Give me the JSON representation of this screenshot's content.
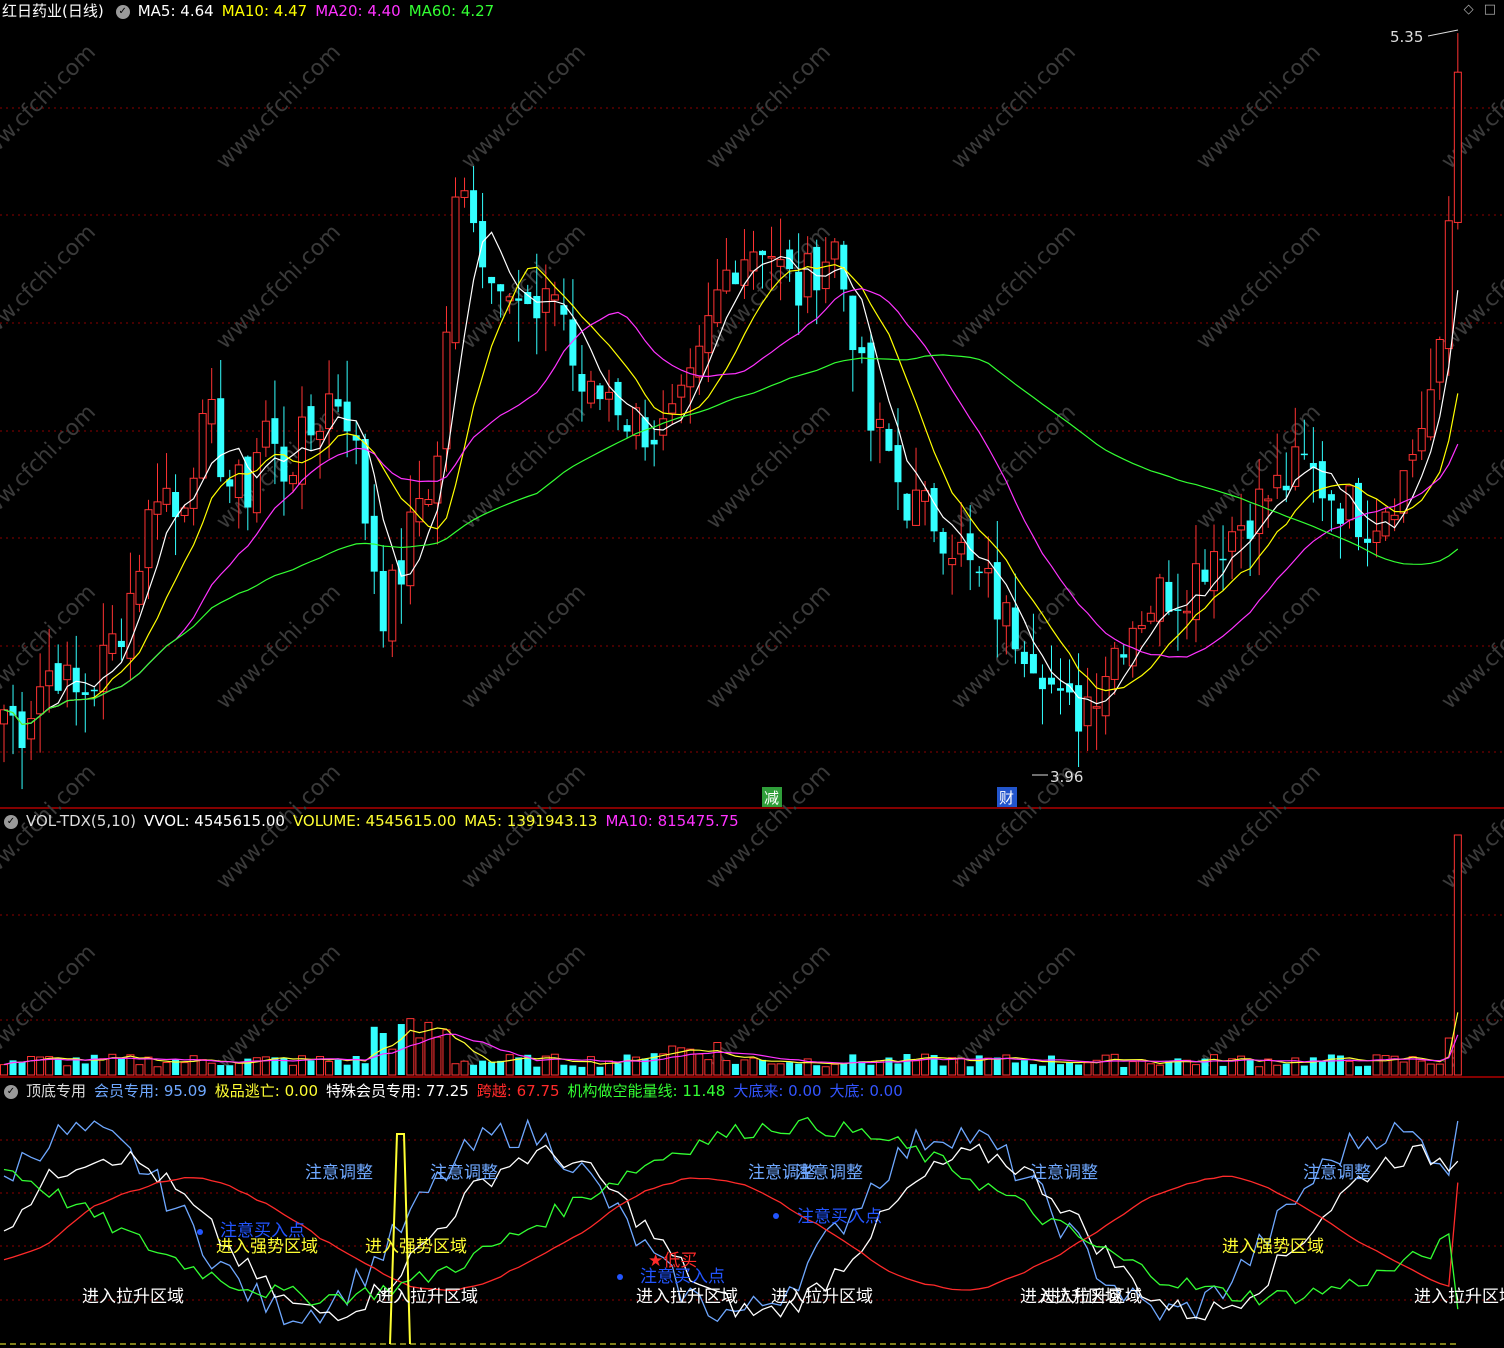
{
  "main_header": {
    "title": "红日药业(日线)",
    "items": [
      {
        "label": "MA5: 4.64",
        "color": "#ffffff"
      },
      {
        "label": "MA10: 4.47",
        "color": "#ffff00"
      },
      {
        "label": "MA20: 4.40",
        "color": "#ff33ff"
      },
      {
        "label": "MA60: 4.27",
        "color": "#33ff33"
      }
    ]
  },
  "volume_header": {
    "title": "VOL-TDX(5,10)",
    "items": [
      {
        "label": "VVOL: 4545615.00",
        "color": "#ffffff"
      },
      {
        "label": "VOLUME: 4545615.00",
        "color": "#ffff33"
      },
      {
        "label": "MA5: 1391943.13",
        "color": "#ffff33"
      },
      {
        "label": "MA10: 815475.75",
        "color": "#ff33ff"
      }
    ]
  },
  "indicator_header": {
    "title": "顶底专用",
    "items": [
      {
        "label": "会员专用: 95.09",
        "color": "#6fa8ff"
      },
      {
        "label": "极品逃亡: 0.00",
        "color": "#ffff33"
      },
      {
        "label": "特殊会员专用: 77.25",
        "color": "#ffffff"
      },
      {
        "label": "跨越: 67.75",
        "color": "#ff2a2a"
      },
      {
        "label": "机构做空能量线: 11.48",
        "color": "#33ff33"
      },
      {
        "label": "大底来: 0.00",
        "color": "#3355ff"
      },
      {
        "label": "大底: 0.00",
        "color": "#3355ff"
      }
    ]
  },
  "window_controls": [
    "◇",
    "□"
  ],
  "price_labels": {
    "high": "5.35",
    "low": "3.96"
  },
  "event_markers": [
    {
      "text": "减",
      "bg": "#2f9e3a"
    },
    {
      "text": "财",
      "bg": "#2255cc"
    }
  ],
  "watermark": "www.cfchi.com",
  "indicator_labels": {
    "attention": "注意调整",
    "strong": "进入强势区域",
    "rise": "进入拉升区域",
    "buy_point": "注意买入点",
    "low_buy": "★低买"
  },
  "colors": {
    "up": "#ff3333",
    "down": "#33ffff",
    "ma5": "#ffffff",
    "ma10": "#ffff00",
    "ma20": "#ff33ff",
    "ma60": "#33ff33",
    "grid": "#8b0000",
    "separator": "#b00000"
  },
  "chart_data": {
    "type": "candlestick",
    "price_ylim": [
      3.85,
      5.45
    ],
    "volume_max": 4545615,
    "closes_key": [
      4.0,
      3.96,
      4.05,
      4.1,
      4.02,
      4.05,
      4.12,
      4.2,
      4.35,
      4.5,
      4.4,
      4.55,
      4.6,
      4.48,
      4.45,
      4.62,
      4.5,
      4.55,
      4.6,
      4.68,
      4.62,
      4.38,
      4.2,
      4.3,
      4.45,
      4.5,
      5.05,
      5.1,
      4.9,
      4.95,
      4.85,
      4.8,
      4.92,
      4.7,
      4.65,
      4.68,
      4.62,
      4.6,
      4.58,
      4.62,
      4.7,
      4.85,
      4.95,
      4.98,
      5.0,
      4.92,
      4.88,
      4.95,
      4.98,
      4.82,
      4.6,
      4.55,
      4.45,
      4.42,
      4.4,
      4.35,
      4.28,
      4.25,
      4.18,
      4.15,
      4.1,
      4.0,
      3.99,
      4.05,
      4.12,
      4.18,
      4.22,
      4.25,
      4.25,
      4.3,
      4.35,
      4.38,
      4.42,
      4.45,
      4.48,
      4.52,
      4.48,
      4.45,
      4.42,
      4.4,
      4.45,
      4.5,
      4.62,
      4.74,
      5.35
    ]
  }
}
